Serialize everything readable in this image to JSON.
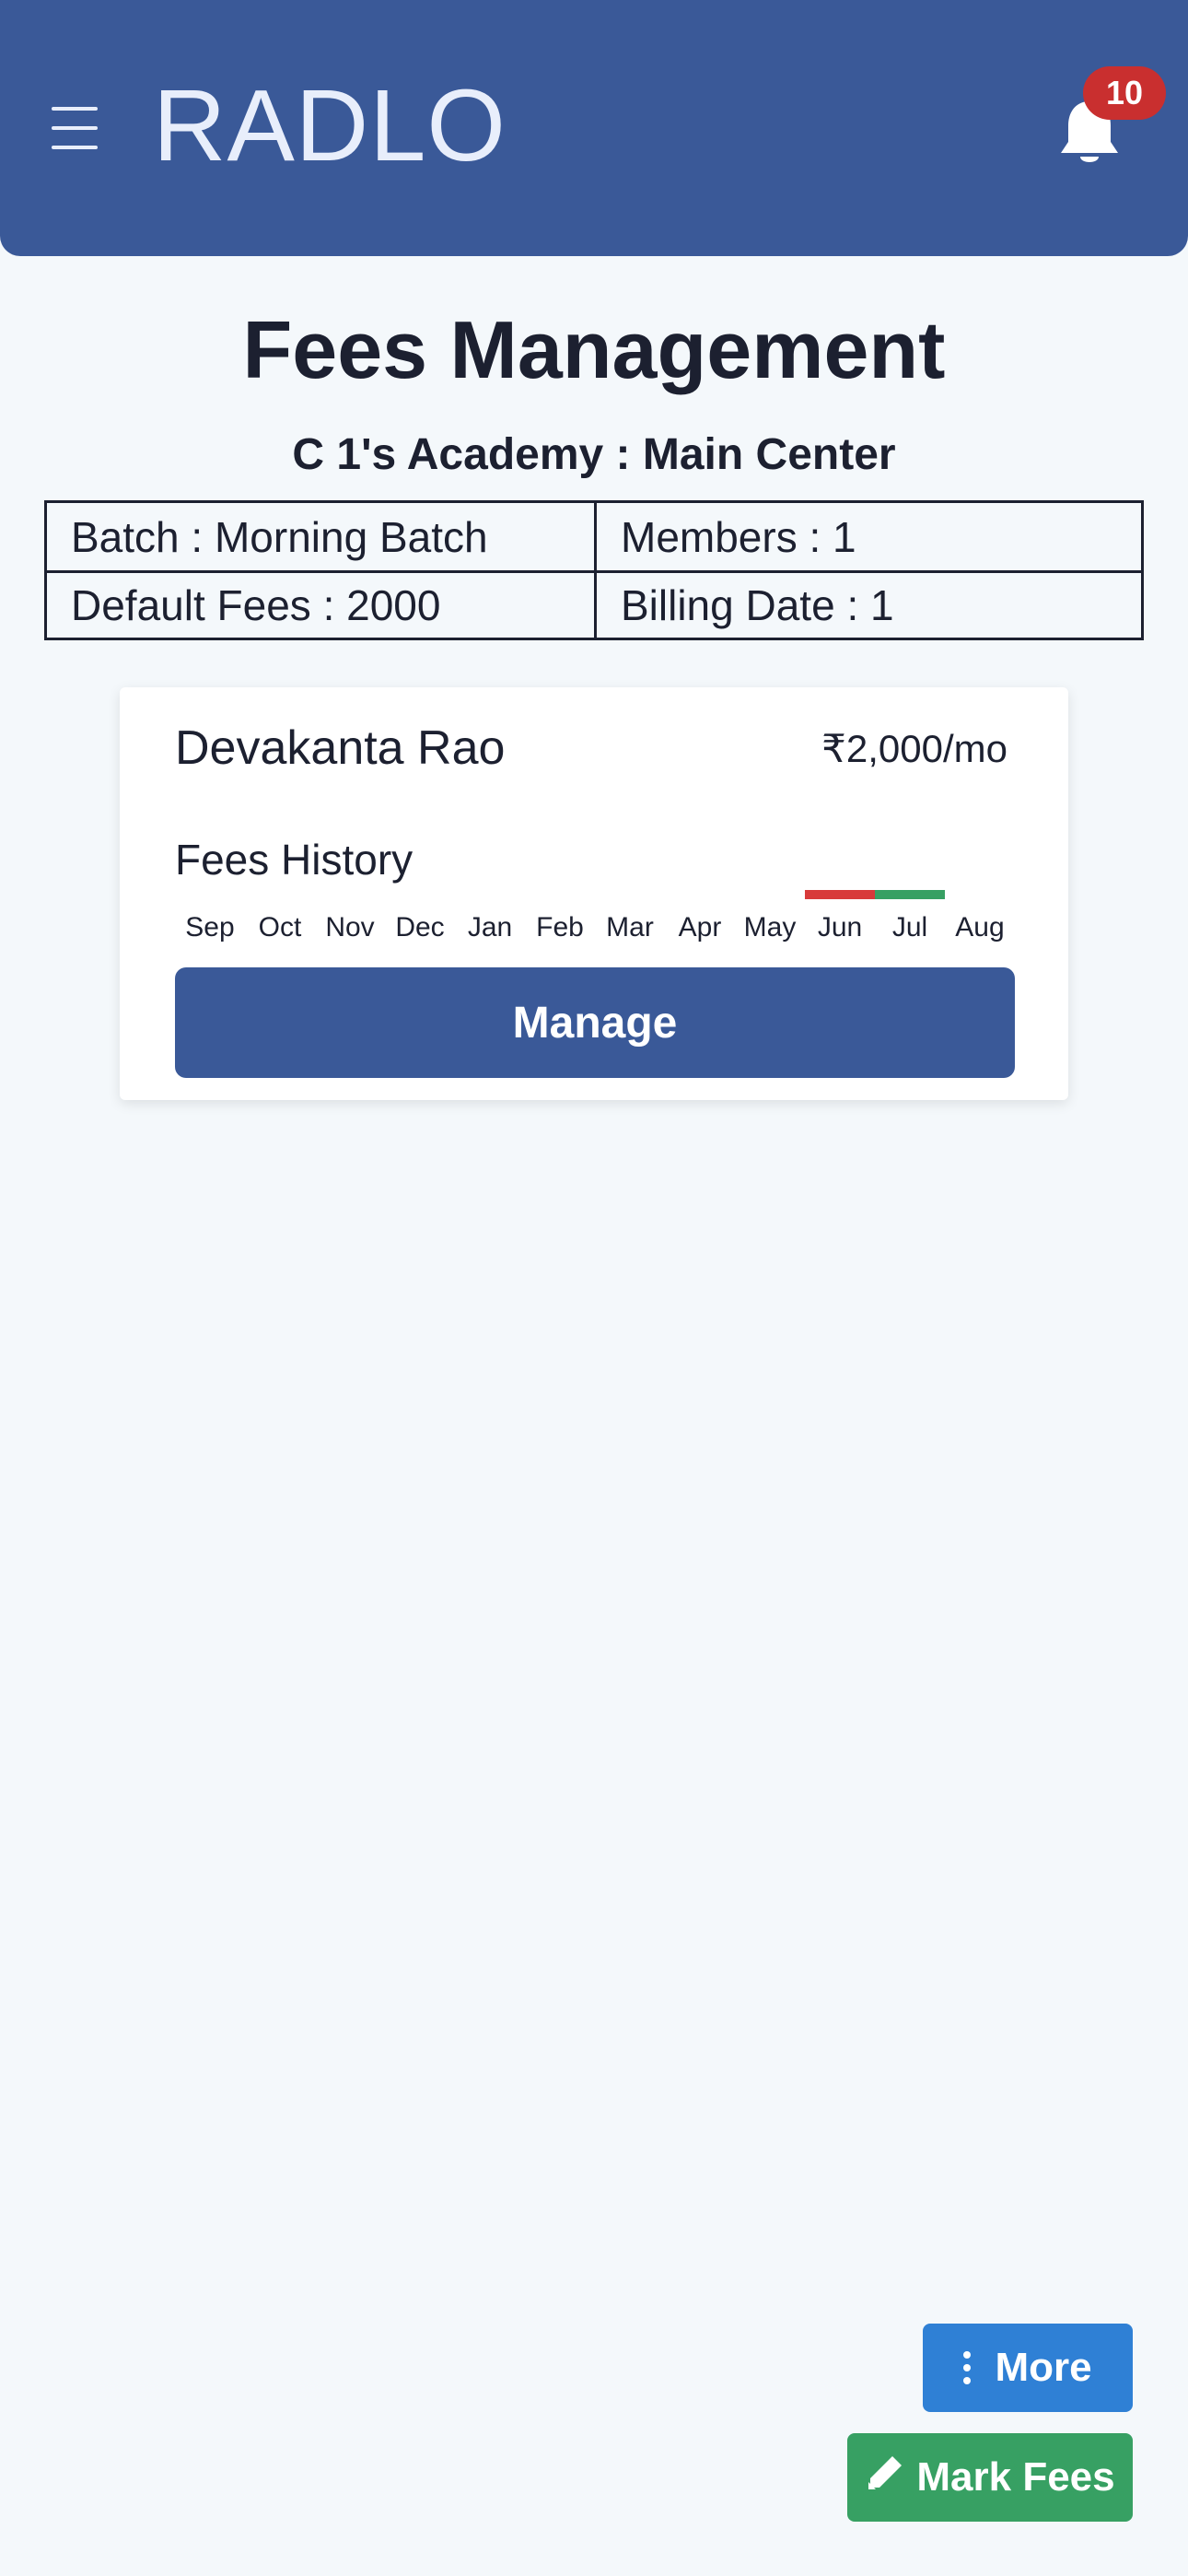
{
  "header": {
    "brand": "RADLO",
    "notification_count": "10",
    "icons": {
      "menu": "hamburger-menu-icon",
      "notifications": "bell-icon"
    }
  },
  "page": {
    "title": "Fees Management",
    "subtitle": "C 1's Academy : Main Center"
  },
  "info": {
    "batch": "Batch : Morning Batch",
    "members": "Members : 1",
    "default_fees": "Default Fees : 2000",
    "billing_date": "Billing Date : 1"
  },
  "member": {
    "name": "Devakanta Rao",
    "fee": "₹2,000/mo",
    "history_title": "Fees History",
    "months": [
      {
        "label": "Sep",
        "status": "none"
      },
      {
        "label": "Oct",
        "status": "none"
      },
      {
        "label": "Nov",
        "status": "none"
      },
      {
        "label": "Dec",
        "status": "none"
      },
      {
        "label": "Jan",
        "status": "none"
      },
      {
        "label": "Feb",
        "status": "none"
      },
      {
        "label": "Mar",
        "status": "none"
      },
      {
        "label": "Apr",
        "status": "none"
      },
      {
        "label": "May",
        "status": "none"
      },
      {
        "label": "Jun",
        "status": "unpaid"
      },
      {
        "label": "Jul",
        "status": "paid"
      },
      {
        "label": "Aug",
        "status": "none"
      }
    ],
    "manage_label": "Manage"
  },
  "actions": {
    "more_label": "More",
    "mark_fees_label": "Mark Fees",
    "icons": {
      "more": "vertical-dots-icon",
      "mark_fees": "pen-icon"
    }
  },
  "colors": {
    "primary": "#3a5998",
    "badge": "#c92f2f",
    "paid": "#37a063",
    "unpaid": "#d83a3a",
    "more_button": "#2f80d5",
    "mark_fees_button": "#37a063",
    "background": "#f4f8fb"
  }
}
